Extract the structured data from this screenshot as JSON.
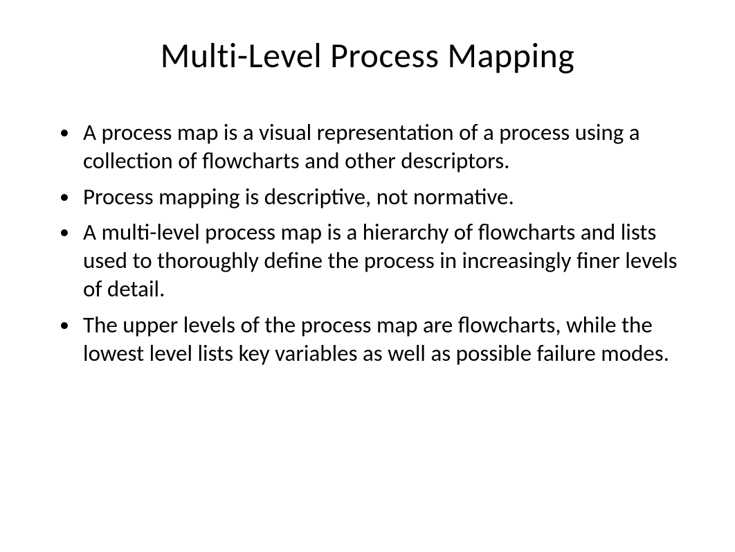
{
  "title": "Multi-Level Process Mapping",
  "bullets": [
    "A process map is a visual representation of a process using a collection of flowcharts and other descriptors.",
    "Process mapping is descriptive, not normative.",
    "A multi-level process map is a hierarchy of flowcharts and lists used to thoroughly define the process in increasingly finer levels of detail.",
    "The upper levels of the process map are flowcharts, while the lowest level lists key variables as well as possible failure modes."
  ]
}
